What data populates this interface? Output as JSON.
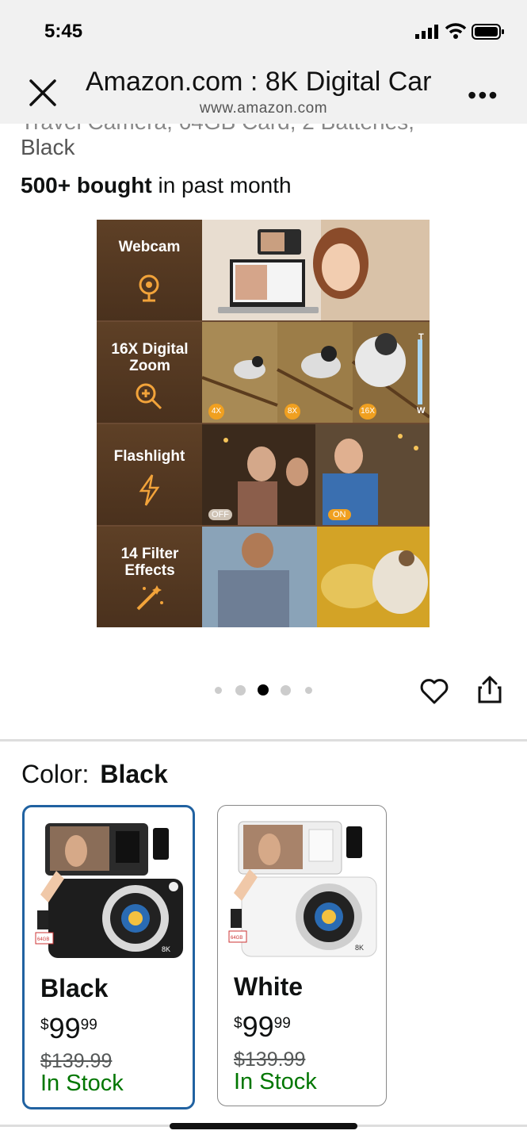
{
  "status": {
    "time": "5:45"
  },
  "browser": {
    "title": "Amazon.com : 8K Digital Car",
    "domain": "www.amazon.com",
    "more": "•••"
  },
  "product": {
    "title_fragment": "Travel Camera, 64GB Card, 2 Batteries,",
    "color_line": "Black",
    "bought_bold": "500+ bought",
    "bought_rest": " in past month"
  },
  "hero": {
    "features": [
      {
        "label": "Webcam",
        "icon": "webcam-icon"
      },
      {
        "label": "16X Digital Zoom",
        "icon": "zoom-in-icon",
        "badges": [
          "4X",
          "8X",
          "16X"
        ],
        "slider": [
          "T",
          "W"
        ]
      },
      {
        "label": "Flashlight",
        "icon": "lightning-icon",
        "badges": [
          "OFF",
          "ON"
        ]
      },
      {
        "label": "14 Filter Effects",
        "icon": "magic-wand-icon"
      }
    ]
  },
  "carousel": {
    "count": 5,
    "active": 3
  },
  "color_selector": {
    "label": "Color:",
    "selected": "Black",
    "options": [
      {
        "name": "Black",
        "currency": "$",
        "whole": "99",
        "cents": "99",
        "was": "$139.99",
        "stock": "In Stock",
        "selected": true,
        "thumb_badges": [
          "8K",
          "64GB"
        ]
      },
      {
        "name": "White",
        "currency": "$",
        "whole": "99",
        "cents": "99",
        "was": "$139.99",
        "stock": "In Stock",
        "selected": false,
        "thumb_badges": [
          "8K",
          "64GB"
        ]
      }
    ]
  },
  "colors": {
    "accent_selected": "#2162a1",
    "in_stock": "#007600",
    "hero_brown": "#5e4026",
    "badge_orange": "#f0a020"
  }
}
